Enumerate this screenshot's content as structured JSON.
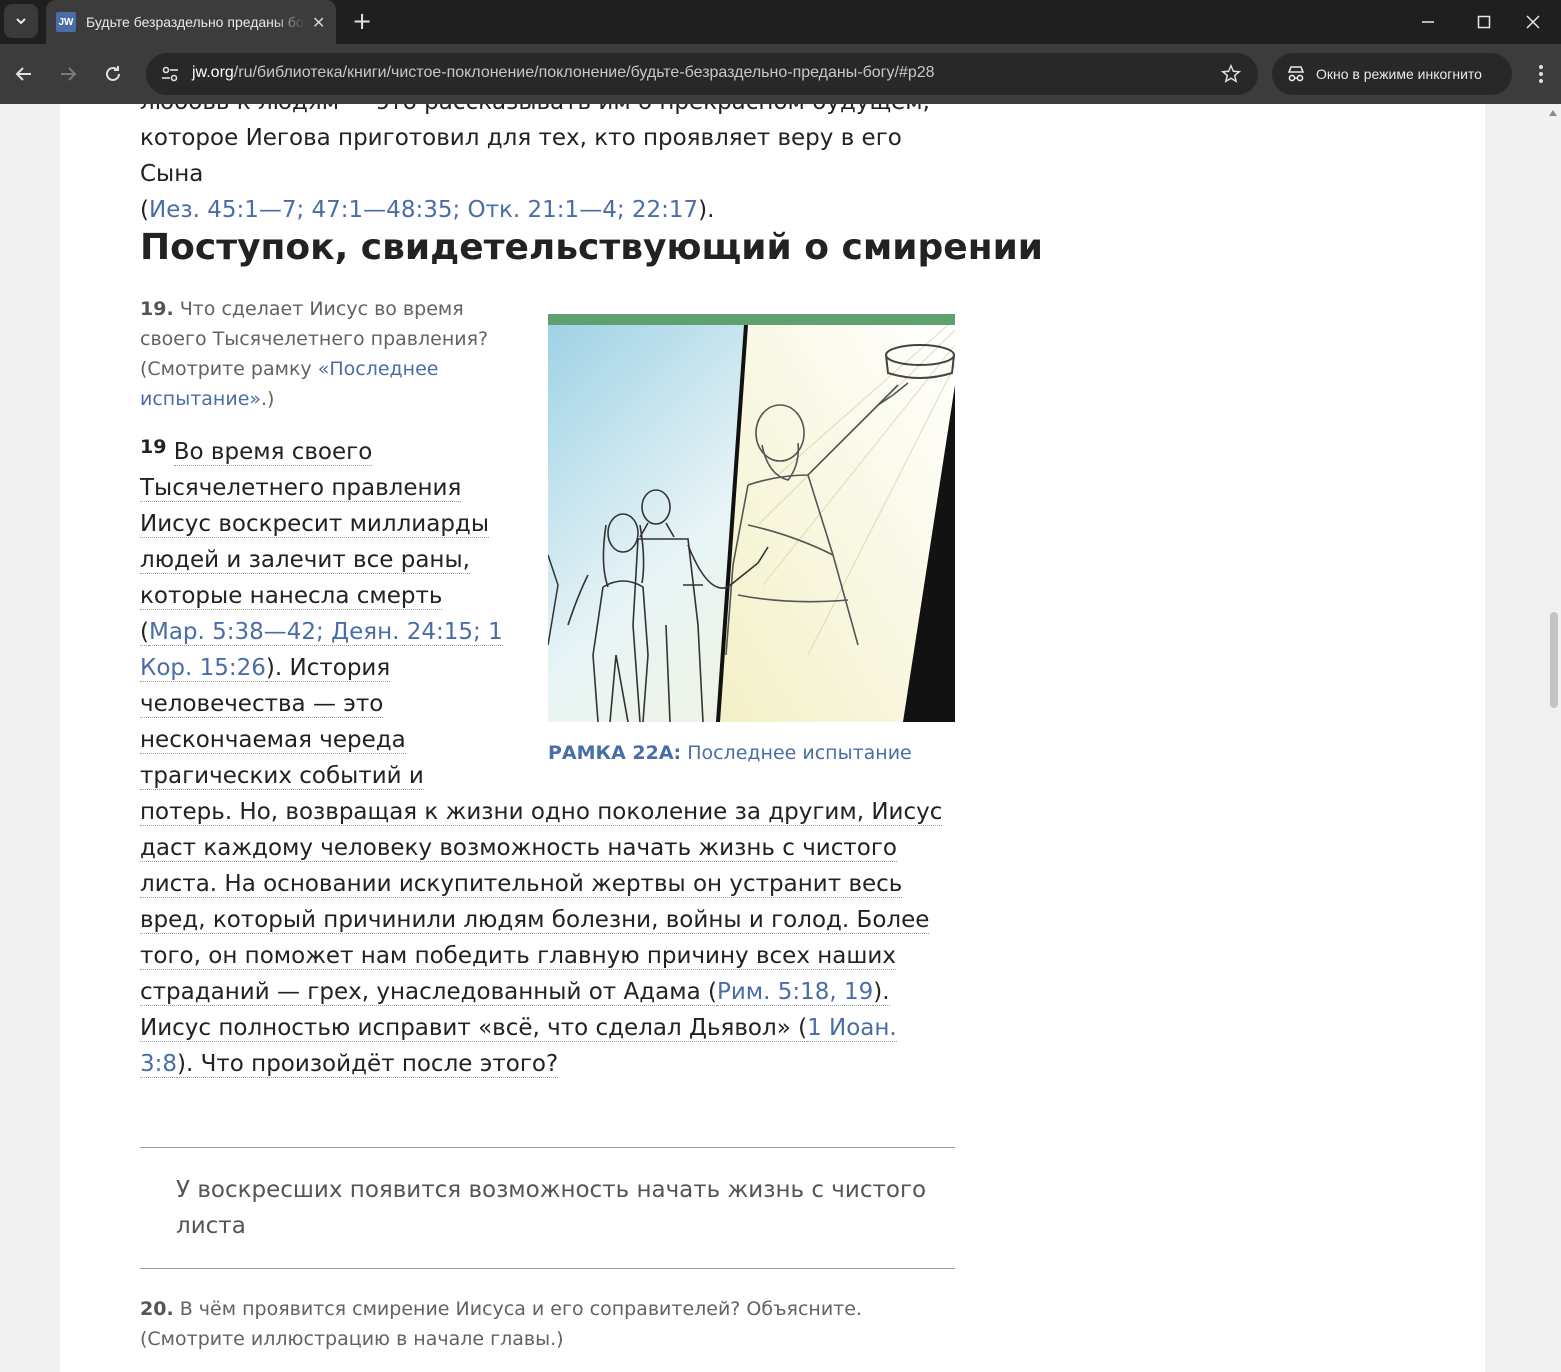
{
  "browser": {
    "tab_title": "Будьте безраздельно преданы богу",
    "favicon_text": "JW",
    "new_tab_label": "+",
    "url_host": "jw.org",
    "url_path": "/ru/библиотека/книги/чистое-поклонение/поклонение/будьте-безраздельно-преданы-богу/#p28",
    "incognito_label": "Окно в режиме инкогнито"
  },
  "article": {
    "top_line_1": "любовь к людям — это рассказывать им о прекрасном будущем,",
    "top_line_2": "которое Иегова приготовил для тех, кто проявляет веру в его Сына",
    "top_open": "(",
    "top_refs": "Иез. 45:1—7; 47:1—48:35; Отк. 21:1—4; 22:17",
    "top_close": ").",
    "heading": "Поступок, свидетельствующий о смирении",
    "q19_num": "19.",
    "q19_text": "Что сделает Иисус во время своего Тысячелетнего правления? (Смотрите рамку ",
    "q19_link": "«Последнее испытание»",
    "q19_end": ".)",
    "figure_caption_label": "РАМКА 22А:",
    "figure_caption_text": "Последнее испытание",
    "p19_num": "19",
    "p19_s1": "Во время своего Тысячелетнего правления Иисус воскресит миллиарды людей и залечит все раны, которые нанесла смерть (",
    "p19_ref1": "Мар. 5:38—42; Деян. 24:15; 1 Кор. 15:26",
    "p19_s2": "). История человечества — это нескончаемая череда трагических событий и потерь. Но, возвращая к жизни одно поколение за другим, Иисус даст каждому человеку возможность начать жизнь с чистого листа. На основании искупительной жертвы он устранит весь вред, который причинили людям болезни, войны и голод. Более того, он поможет нам победить главную причину всех наших страданий — грех, унаследованный от Адама (",
    "p19_ref2": "Рим. 5:18, 19",
    "p19_s3": "). Иисус полностью исправит «всё, что сделал Дьявол» (",
    "p19_ref3": "1 Иоан. 3:8",
    "p19_s4": "). Что произойдёт после этого?",
    "pullquote": "У воскресших появится возможность начать жизнь с чистого листа",
    "q20_num": "20.",
    "q20_text": "В чём проявится смирение Иисуса и его соправителей? Объясните. (Смотрите иллюстрацию в начале главы.)"
  }
}
